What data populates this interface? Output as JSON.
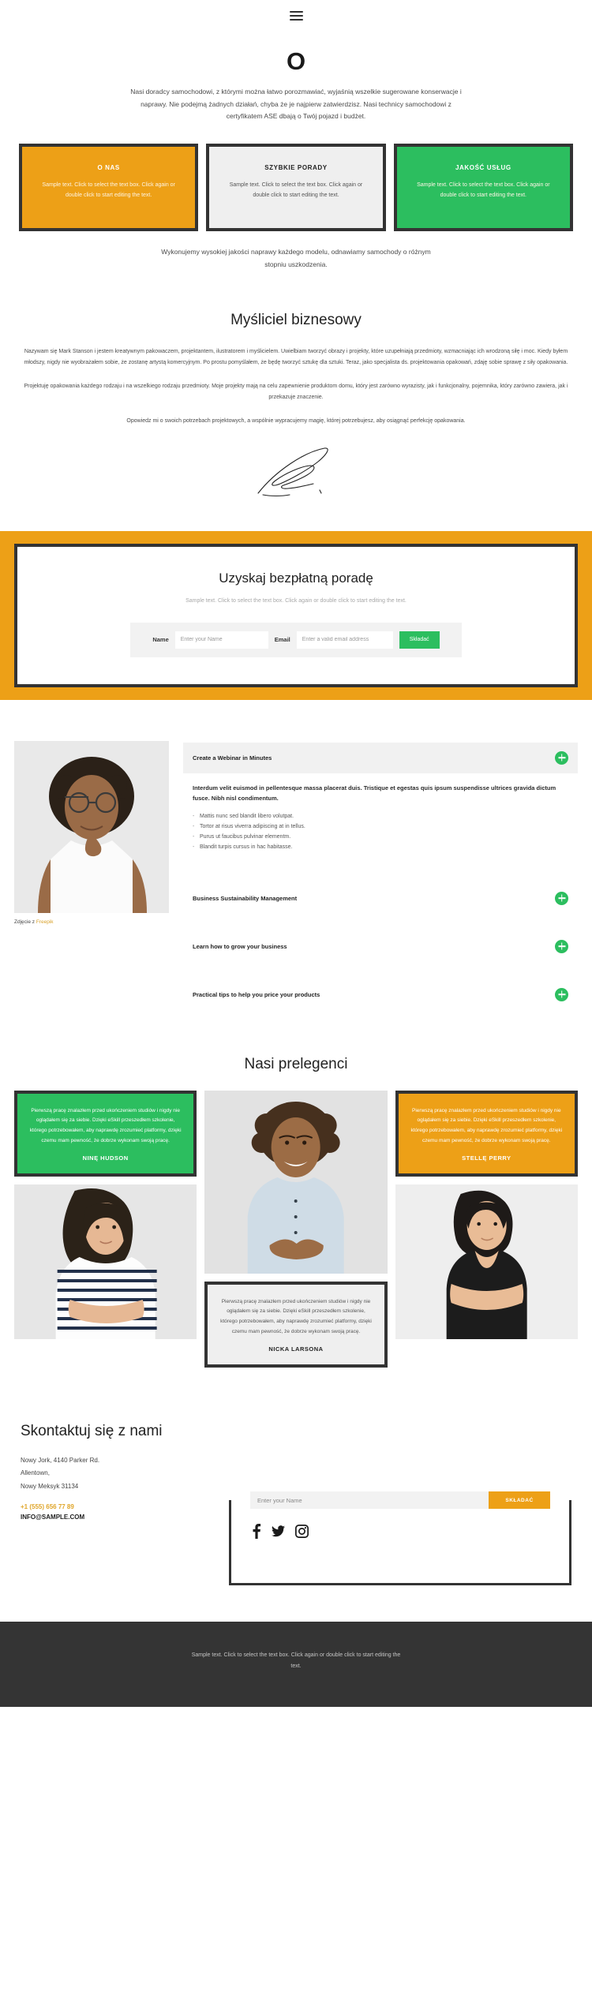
{
  "header": {
    "menu_icon": "hamburger-icon"
  },
  "intro": {
    "logo": "O",
    "text": "Nasi doradcy samochodowi, z którymi można łatwo porozmawiać, wyjaśnią wszelkie sugerowane konserwacje i naprawy. Nie podejmą żadnych działań, chyba że je najpierw zatwierdzisz. Nasi technicy samochodowi z certyfikatem ASE dbają o Twój pojazd i budżet."
  },
  "cards": [
    {
      "title": "O NAS",
      "body": "Sample text. Click to select the text box. Click again or double click to start editing the text.",
      "color": "#eda017"
    },
    {
      "title": "SZYBKIE PORADY",
      "body": "Sample text. Click to select the text box. Click again or double click to start editing the text.",
      "color": "#efefef"
    },
    {
      "title": "JAKOŚĆ USŁUG",
      "body": "Sample text. Click to select the text box. Click again or double click to start editing the text.",
      "color": "#2cbe5f"
    }
  ],
  "quality_text": "Wykonujemy wysokiej jakości naprawy każdego modelu, odnawiamy samochody o różnym stopniu uszkodzenia.",
  "bio": {
    "heading": "Myśliciel biznesowy",
    "p1": "Nazywam się Mark Stanson i jestem kreatywnym pakowaczem, projektantem, ilustratorem i myślicielem. Uwielbiam tworzyć obrazy i projekty, które uzupełniają przedmioty, wzmacniając ich wrodzoną siłę i moc. Kiedy byłem młodszy, nigdy nie wyobrażałem sobie, że zostanę artystą komercyjnym. Po prostu pomyślałem, że będę tworzyć sztukę dla sztuki. Teraz, jako specjalista ds. projektowania opakowań, zdaję sobie sprawę z siły opakowania.",
    "p2": "Projektuję opakowania każdego rodzaju i na wszelkiego rodzaju przedmioty. Moje projekty mają na celu zapewnienie produktom domu, który jest zarówno wyrazisty, jak i funkcjonalny, pojemnika, który zarówno zawiera, jak i przekazuje znaczenie.",
    "p3": "Opowiedz mi o swoich potrzebach projektowych, a wspólnie wypracujemy magię, której potrzebujesz, aby osiągnąć perfekcję opakowania."
  },
  "cta": {
    "heading": "Uzyskaj bezpłatną poradę",
    "subtext": "Sample text. Click to select the text box. Click again or double click to start editing the text.",
    "name_label": "Name",
    "name_placeholder": "Enter your Name",
    "email_label": "Email",
    "email_placeholder": "Enter a valid email address",
    "submit_label": "Składać",
    "submit_color": "#2cbe5f",
    "band_color": "#eda017"
  },
  "feature": {
    "caption_prefix": "Zdjęcie z ",
    "caption_link": "Freepik",
    "accordion": [
      {
        "title": "Create a Webinar in Minutes",
        "open": true
      },
      {
        "title": "Business Sustainability Management",
        "open": false
      },
      {
        "title": "Learn how to grow your business",
        "open": false
      },
      {
        "title": "Practical tips to help you price your products",
        "open": false
      }
    ],
    "panel": {
      "lead": "Interdum velit euismod in pellentesque massa placerat duis. Tristique et egestas quis ipsum suspendisse ultrices gravida dictum fusce. Nibh nisl condimentum.",
      "bullets": [
        "Mattis nunc sed blandit libero volutpat.",
        "Tortor at risus viverra adipiscing at in tellus.",
        "Purus ut faucibus pulvinar elementm.",
        "Blandit turpis cursus in hac habitasse."
      ]
    }
  },
  "speakers": {
    "heading": "Nasi prelegenci",
    "quote": "Pierwszą pracę znalazłem przed ukończeniem studiów i nigdy nie oglądałem się za siebie. Dzięki eSkill przeszedłem szkolenie, którego potrzebowałem, aby naprawdę zrozumieć platformy, dzięki czemu mam pewność, że dobrze wykonam swoją pracę.",
    "names": [
      "NINĘ HUDSON",
      "STELLĘ PERRY",
      "NICKA LARSONA"
    ]
  },
  "contact": {
    "heading": "Skontaktuj się z nami",
    "address_line1": "Nowy Jork, 4140 Parker Rd.",
    "address_line2": "Allentown,",
    "address_line3": "Nowy Meksyk 31134",
    "phone": "+1 (555) 656 77 89",
    "email": "INFO@SAMPLE.COM",
    "phone_color": "#e0a62b",
    "subscribe_placeholder": "Enter your Name",
    "subscribe_label": "SKŁADAĆ",
    "subscribe_color": "#eda017",
    "socials": [
      "facebook-icon",
      "twitter-icon",
      "instagram-icon"
    ]
  },
  "footer": {
    "text": "Sample text. Click to select the text box. Click again or double click to start editing the text."
  }
}
